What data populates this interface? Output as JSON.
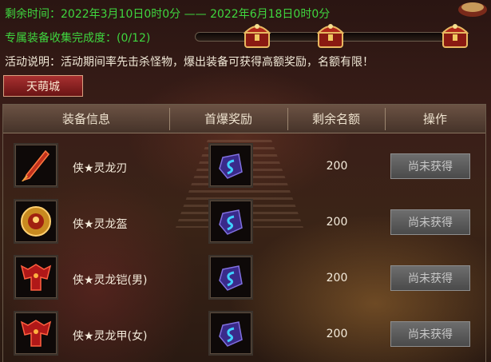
{
  "header": {
    "time_text": "剩余时间：2022年3月10日0时0分 —— 2022年6月18日0时0分",
    "collect_text": "专属装备收集完成度：(0/12)",
    "desc_text": "活动说明：活动期间率先击杀怪物，爆出装备可获得高额奖励，名额有限！",
    "progress": 0
  },
  "chests": [
    "treasure-chest-icon",
    "treasure-chest-icon",
    "treasure-chest-icon"
  ],
  "city_tab": "天萌城",
  "table": {
    "headers": [
      "装备信息",
      "首爆奖励",
      "剩余名额",
      "操作"
    ],
    "rows": [
      {
        "icon": "red-sword-icon",
        "name": "侠★灵龙刃",
        "reward_icon": "blue-gem-icon",
        "remain": "200",
        "action": "尚未获得"
      },
      {
        "icon": "gold-helmet-icon",
        "name": "侠★灵龙盔",
        "reward_icon": "blue-gem-icon",
        "remain": "200",
        "action": "尚未获得"
      },
      {
        "icon": "red-armor-icon",
        "name": "侠★灵龙铠(男)",
        "reward_icon": "blue-gem-icon",
        "remain": "200",
        "action": "尚未获得"
      },
      {
        "icon": "red-armor-icon",
        "name": "侠★灵龙甲(女)",
        "reward_icon": "blue-gem-icon",
        "remain": "200",
        "action": "尚未获得"
      }
    ]
  },
  "colors": {
    "green_text": "#3fd63f",
    "tab_red": "#a83030",
    "button_gray": "#5a5a5a"
  }
}
